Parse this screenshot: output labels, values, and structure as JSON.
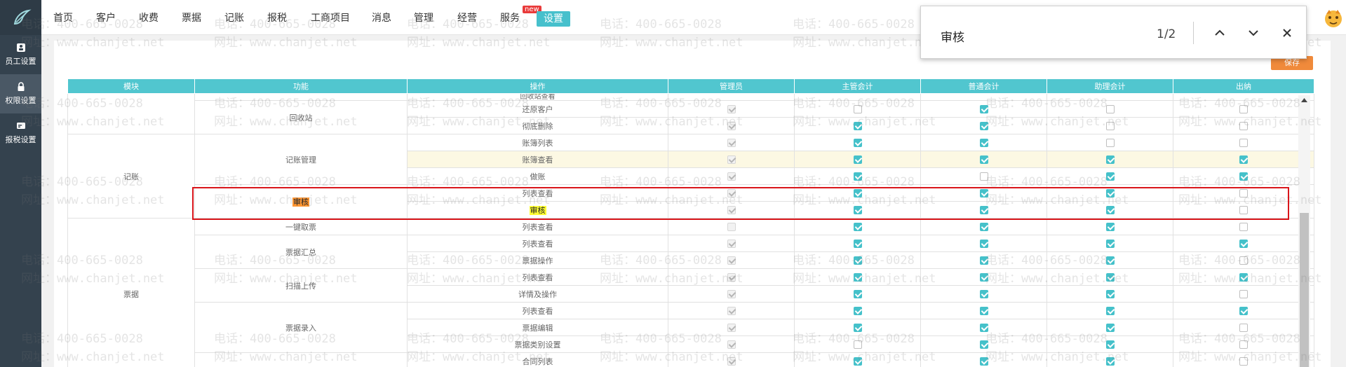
{
  "sidebar": {
    "items": [
      {
        "label": "员工设置",
        "icon": "employee-icon",
        "active": false
      },
      {
        "label": "权限设置",
        "icon": "lock-icon",
        "active": true
      },
      {
        "label": "报税设置",
        "icon": "tax-icon",
        "active": false
      }
    ]
  },
  "nav": {
    "items": [
      "首页",
      "客户",
      "收费",
      "票据",
      "记账",
      "报税",
      "工商项目",
      "消息",
      "管理",
      "经营",
      "服务",
      "设置"
    ],
    "new_badge": "new",
    "active": "设置"
  },
  "watermark": {
    "phone": "电话：400-665-0028",
    "site": "网址：www.chanjet.net"
  },
  "toolbar": {
    "save_label": "保存"
  },
  "find_bar": {
    "query": "审核",
    "count": "1/2"
  },
  "table": {
    "headers": [
      "模块",
      "功能",
      "操作",
      "管理员",
      "主管会计",
      "普通会计",
      "助理会计",
      "出纳"
    ],
    "partial_top_label": "回收站查看",
    "groups": [
      {
        "module": "",
        "functions": [
          {
            "name": "回收站",
            "ops": [
              {
                "op": "还原客户",
                "cb": [
                  [
                    1,
                    1
                  ],
                  [
                    0,
                    0
                  ],
                  [
                    1,
                    0
                  ],
                  [
                    0,
                    0
                  ],
                  [
                    0,
                    0
                  ]
                ]
              },
              {
                "op": "彻底删除",
                "cb": [
                  [
                    1,
                    1
                  ],
                  [
                    1,
                    0
                  ],
                  [
                    1,
                    0
                  ],
                  [
                    0,
                    0
                  ],
                  [
                    0,
                    0
                  ]
                ]
              }
            ]
          }
        ]
      },
      {
        "module": "记账",
        "functions": [
          {
            "name": "记账管理",
            "ops": [
              {
                "op": "账簿列表",
                "cb": [
                  [
                    1,
                    1
                  ],
                  [
                    1,
                    0
                  ],
                  [
                    1,
                    0
                  ],
                  [
                    0,
                    0
                  ],
                  [
                    0,
                    0
                  ]
                ]
              },
              {
                "op": "账簿查看",
                "cb": [
                  [
                    1,
                    1
                  ],
                  [
                    1,
                    0
                  ],
                  [
                    1,
                    0
                  ],
                  [
                    1,
                    0
                  ],
                  [
                    1,
                    0
                  ]
                ],
                "highlight": true
              },
              {
                "op": "做账",
                "cb": [
                  [
                    1,
                    1
                  ],
                  [
                    1,
                    0
                  ],
                  [
                    0,
                    0
                  ],
                  [
                    1,
                    0
                  ],
                  [
                    1,
                    0
                  ]
                ]
              }
            ]
          },
          {
            "name": "审核",
            "mark": true,
            "ops": [
              {
                "op": "列表查看",
                "cb": [
                  [
                    1,
                    1
                  ],
                  [
                    1,
                    0
                  ],
                  [
                    1,
                    0
                  ],
                  [
                    1,
                    0
                  ],
                  [
                    0,
                    0
                  ]
                ]
              },
              {
                "op": "审核",
                "mark": true,
                "cb": [
                  [
                    1,
                    1
                  ],
                  [
                    1,
                    0
                  ],
                  [
                    1,
                    0
                  ],
                  [
                    1,
                    0
                  ],
                  [
                    0,
                    0
                  ]
                ]
              }
            ]
          }
        ]
      },
      {
        "module": "票据",
        "functions": [
          {
            "name": "一键取票",
            "ops": [
              {
                "op": "列表查看",
                "cb": [
                  [
                    0,
                    1
                  ],
                  [
                    1,
                    0
                  ],
                  [
                    1,
                    0
                  ],
                  [
                    1,
                    0
                  ],
                  [
                    0,
                    0
                  ]
                ]
              }
            ]
          },
          {
            "name": "票据汇总",
            "ops": [
              {
                "op": "列表查看",
                "cb": [
                  [
                    1,
                    1
                  ],
                  [
                    1,
                    0
                  ],
                  [
                    1,
                    0
                  ],
                  [
                    1,
                    0
                  ],
                  [
                    1,
                    0
                  ]
                ]
              },
              {
                "op": "票据操作",
                "cb": [
                  [
                    1,
                    1
                  ],
                  [
                    1,
                    0
                  ],
                  [
                    1,
                    0
                  ],
                  [
                    1,
                    0
                  ],
                  [
                    0,
                    0
                  ]
                ]
              }
            ]
          },
          {
            "name": "扫描上传",
            "ops": [
              {
                "op": "列表查看",
                "cb": [
                  [
                    1,
                    1
                  ],
                  [
                    1,
                    0
                  ],
                  [
                    1,
                    0
                  ],
                  [
                    1,
                    0
                  ],
                  [
                    1,
                    0
                  ]
                ]
              },
              {
                "op": "详情及操作",
                "cb": [
                  [
                    1,
                    1
                  ],
                  [
                    1,
                    0
                  ],
                  [
                    1,
                    0
                  ],
                  [
                    1,
                    0
                  ],
                  [
                    0,
                    0
                  ]
                ]
              }
            ]
          },
          {
            "name": "票据录入",
            "ops": [
              {
                "op": "列表查看",
                "cb": [
                  [
                    1,
                    1
                  ],
                  [
                    1,
                    0
                  ],
                  [
                    1,
                    0
                  ],
                  [
                    1,
                    0
                  ],
                  [
                    1,
                    0
                  ]
                ]
              },
              {
                "op": "票据编辑",
                "cb": [
                  [
                    1,
                    1
                  ],
                  [
                    1,
                    0
                  ],
                  [
                    1,
                    0
                  ],
                  [
                    1,
                    0
                  ],
                  [
                    0,
                    0
                  ]
                ]
              },
              {
                "op": "票据类别设置",
                "cb": [
                  [
                    1,
                    1
                  ],
                  [
                    0,
                    0
                  ],
                  [
                    1,
                    0
                  ],
                  [
                    1,
                    0
                  ],
                  [
                    0,
                    0
                  ]
                ]
              }
            ]
          },
          {
            "name": "",
            "ops": [
              {
                "op": "合同列表",
                "cb": [
                  [
                    1,
                    1
                  ],
                  [
                    1,
                    0
                  ],
                  [
                    1,
                    0
                  ],
                  [
                    1,
                    0
                  ],
                  [
                    0,
                    0
                  ]
                ]
              }
            ]
          }
        ]
      }
    ]
  },
  "colors": {
    "sidebar_bg": "#34424e",
    "header_teal": "#51c6cf",
    "checkbox_on": "#45c1ca",
    "save_orange": "#f08a3b",
    "highlight_red": "#d9161b",
    "search_mark": "#ffff33"
  }
}
